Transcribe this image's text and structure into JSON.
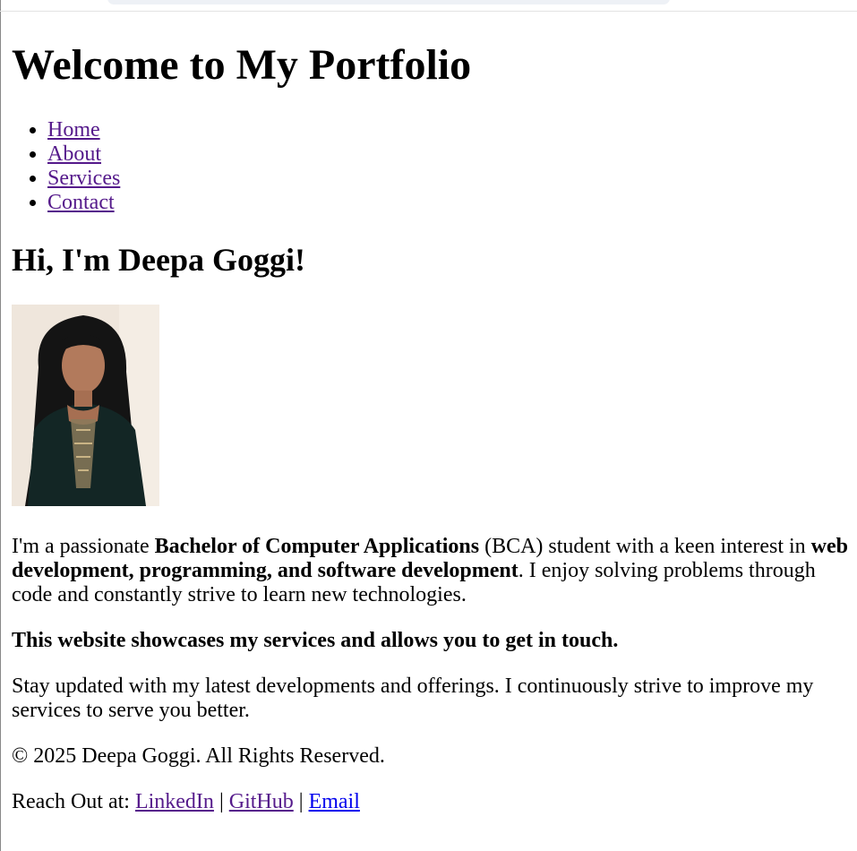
{
  "header": {
    "title": "Welcome to My Portfolio"
  },
  "nav": {
    "items": [
      "Home",
      "About",
      "Services",
      "Contact"
    ]
  },
  "hero": {
    "greeting": "Hi, I'm Deepa Goggi!"
  },
  "about": {
    "p1_a": "I'm a passionate ",
    "p1_b": "Bachelor of Computer Applications",
    "p1_c": " (BCA) student with a keen interest in ",
    "p1_d": "web development, programming, and software development",
    "p1_e": ". I enjoy solving problems through code and constantly strive to learn new technologies.",
    "p2": "This website showcases my services and allows you to get in touch.",
    "p3": "Stay updated with my latest developments and offerings. I continuously strive to improve my services to serve you better."
  },
  "footer": {
    "copyright": "© 2025 Deepa Goggi. All Rights Reserved.",
    "reach_label": "Reach Out at: ",
    "linkedin": "LinkedIn",
    "github": "GitHub",
    "email": "Email",
    "separator": " | "
  },
  "colors": {
    "visited_link": "#551a8b",
    "link": "#0000ee"
  }
}
